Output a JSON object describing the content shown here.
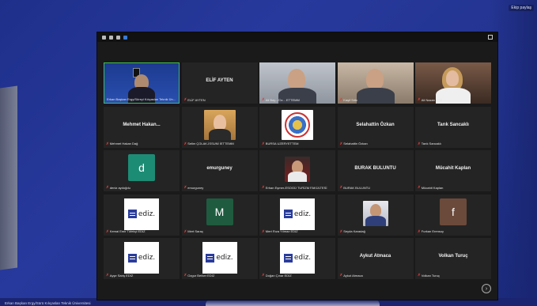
{
  "screen": {
    "corner_tag": "Ekip paylaş",
    "bottom_caption": "Erkan Başkan Ergy/Sürü Kılıçaslan Teknik Üniversitesi"
  },
  "meeting": {
    "tiles": [
      {
        "id": "t1",
        "display": "",
        "label": "Erkan Başkan Ergy/Süreyi Kılıçaslan Teknik Ün...",
        "muted": false,
        "type": "video-host"
      },
      {
        "id": "t2",
        "display": "ELİF AYTEN",
        "label": "ELİF AYTEN",
        "muted": true,
        "type": "name"
      },
      {
        "id": "t3",
        "display": "",
        "label": "Ali Bay.../Oz... ETTEMM",
        "muted": true,
        "type": "video-man"
      },
      {
        "id": "t4",
        "display": "",
        "label": "Kaşif Sıtkı",
        "muted": true,
        "type": "video-man2"
      },
      {
        "id": "t5",
        "display": "",
        "label": "Ali Nazan TYO",
        "muted": true,
        "type": "video-woman"
      },
      {
        "id": "t6",
        "display": "Mehmet Hakan...",
        "label": "Mehmet Hakan Dağ",
        "muted": true,
        "type": "name"
      },
      {
        "id": "t7",
        "display": "",
        "label": "Selim ÇOLAK-İSSUNİ İETTEMM",
        "muted": true,
        "type": "photo-woman"
      },
      {
        "id": "t8",
        "display": "",
        "label": "BURSA UZERYETTEM",
        "muted": true,
        "type": "seal"
      },
      {
        "id": "t9",
        "display": "Selahattin Özkan",
        "label": "Selahattin Özkan",
        "muted": true,
        "type": "name"
      },
      {
        "id": "t10",
        "display": "Tarık Sancaklı",
        "label": "Tarık Sancaklı",
        "muted": true,
        "type": "name"
      },
      {
        "id": "t11",
        "display": "",
        "label": "deniz aydoğdu",
        "muted": true,
        "type": "avatar-d"
      },
      {
        "id": "t12",
        "display": "emurguney",
        "label": "emurguney",
        "muted": true,
        "type": "name"
      },
      {
        "id": "t13",
        "display": "",
        "label": "Erhan Eşmer-ESOGÜ TURİZM FAKÜLTESİ",
        "muted": true,
        "type": "photo-small"
      },
      {
        "id": "t14",
        "display": "BURAK BULUNTU",
        "label": "BURAK BULUNTU",
        "muted": true,
        "type": "name"
      },
      {
        "id": "t15",
        "display": "Mücahit Kaplan",
        "label": "Mücahit Kaplan",
        "muted": true,
        "type": "name"
      },
      {
        "id": "t16",
        "display": "",
        "label": "Kemal Emir Tüfekçi EDİZ",
        "muted": true,
        "type": "ediz"
      },
      {
        "id": "t17",
        "display": "",
        "label": "Mert Saraç",
        "muted": true,
        "type": "avatar-m"
      },
      {
        "id": "t18",
        "display": "",
        "label": "Mert Rıza Yılmaz EDİZ",
        "muted": true,
        "type": "ediz"
      },
      {
        "id": "t19",
        "display": "",
        "label": "Seyda Karadağ",
        "muted": true,
        "type": "photo-man"
      },
      {
        "id": "t20",
        "display": "",
        "label": "Furkan Erensoy",
        "muted": true,
        "type": "avatar-f"
      },
      {
        "id": "t21",
        "display": "",
        "label": "Ayşe Sarış EDİZ",
        "muted": true,
        "type": "ediz"
      },
      {
        "id": "t22",
        "display": "",
        "label": "Ozgur Berker EDİZ",
        "muted": true,
        "type": "ediz"
      },
      {
        "id": "t23",
        "display": "",
        "label": "Doğan Çınar EDİZ",
        "muted": true,
        "type": "ediz"
      },
      {
        "id": "t24",
        "display": "Aykut Atmaca",
        "label": "Aykut Atmaca",
        "muted": true,
        "type": "name"
      },
      {
        "id": "t25",
        "display": "Volkan Turuç",
        "label": "Volkan Turuç",
        "muted": true,
        "type": "name"
      }
    ],
    "avatar_letters": {
      "d": "d",
      "m": "M",
      "f": "f"
    },
    "ediz_text": "ediz.",
    "mic_icon": "✗",
    "next_icon": "›"
  },
  "colors": {
    "active_border": "#3fbf4f",
    "mic_muted": "#e23b3b",
    "avatar_d": "#1d8c75",
    "avatar_m": "#1f5c3f",
    "avatar_f": "#6b4a3b"
  }
}
